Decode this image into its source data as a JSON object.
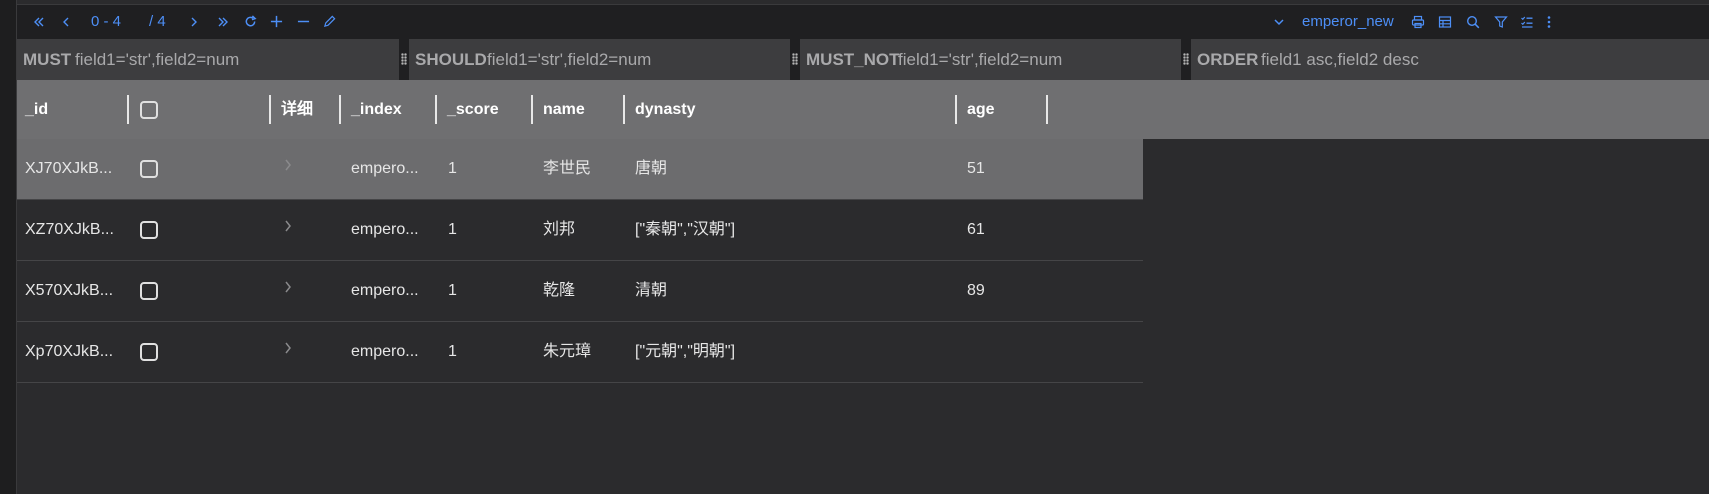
{
  "toolbar": {
    "first_page_icon": "double-left-icon",
    "prev_page_icon": "left-icon",
    "range": "0 - 4",
    "total": "/ 4",
    "next_page_icon": "right-icon",
    "last_page_icon": "double-right-icon",
    "refresh_icon": "refresh-icon",
    "add_icon": "plus-icon",
    "remove_icon": "minus-icon",
    "edit_icon": "edit-icon",
    "index_name": "emperor_new",
    "accent": "#4d8ff7"
  },
  "filters": {
    "must": {
      "keyword": "MUST",
      "placeholder": "field1='str',field2=num"
    },
    "should": {
      "keyword": "SHOULD",
      "placeholder": "field1='str',field2=num"
    },
    "must_not": {
      "keyword": "MUST_NOT",
      "placeholder": "field1='str',field2=num"
    },
    "order": {
      "keyword": "ORDER",
      "placeholder": "field1 asc,field2 desc"
    }
  },
  "table": {
    "columns": [
      "_id",
      "",
      "详细",
      "_index",
      "_score",
      "name",
      "dynasty",
      "age"
    ],
    "rows": [
      {
        "id": "XJ70XJkB...",
        "index": "empero...",
        "score": "1",
        "name": "李世民",
        "dynasty": "唐朝",
        "age": "51"
      },
      {
        "id": "XZ70XJkB...",
        "index": "empero...",
        "score": "1",
        "name": "刘邦",
        "dynasty": "[\"秦朝\",\"汉朝\"]",
        "age": "61"
      },
      {
        "id": "X570XJkB...",
        "index": "empero...",
        "score": "1",
        "name": "乾隆",
        "dynasty": "清朝",
        "age": "89"
      },
      {
        "id": "Xp70XJkB...",
        "index": "empero...",
        "score": "1",
        "name": "朱元璋",
        "dynasty": "[\"元朝\",\"明朝\"]",
        "age": ""
      }
    ]
  }
}
